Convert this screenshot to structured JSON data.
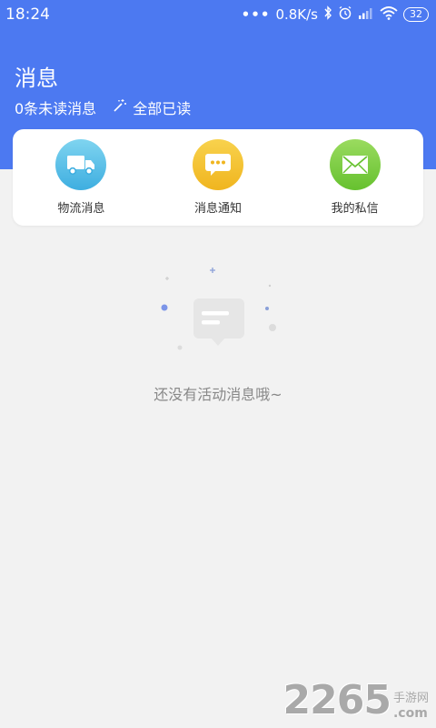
{
  "status_bar": {
    "time": "18:24",
    "dots": "•••",
    "network_speed": "0.8K/s",
    "battery": "32",
    "icons": [
      "bluetooth-icon",
      "alarm-icon",
      "signal-icon",
      "wifi-icon",
      "battery-icon"
    ]
  },
  "header": {
    "title": "消息",
    "unread": "0条未读消息",
    "read_all": "全部已读"
  },
  "categories": [
    {
      "label": "物流消息",
      "icon": "truck-icon",
      "color": "#4ec3e8"
    },
    {
      "label": "消息通知",
      "icon": "chat-bubble-icon",
      "color": "#f5c431"
    },
    {
      "label": "我的私信",
      "icon": "mail-icon",
      "color": "#7fcf3f"
    }
  ],
  "empty_state": {
    "text": "还没有活动消息哦~"
  },
  "watermark": {
    "number": "2265",
    "cn": "手游网",
    "com": ".com"
  },
  "colors": {
    "header_bg": "#4c79f1",
    "page_bg": "#f2f2f2"
  }
}
